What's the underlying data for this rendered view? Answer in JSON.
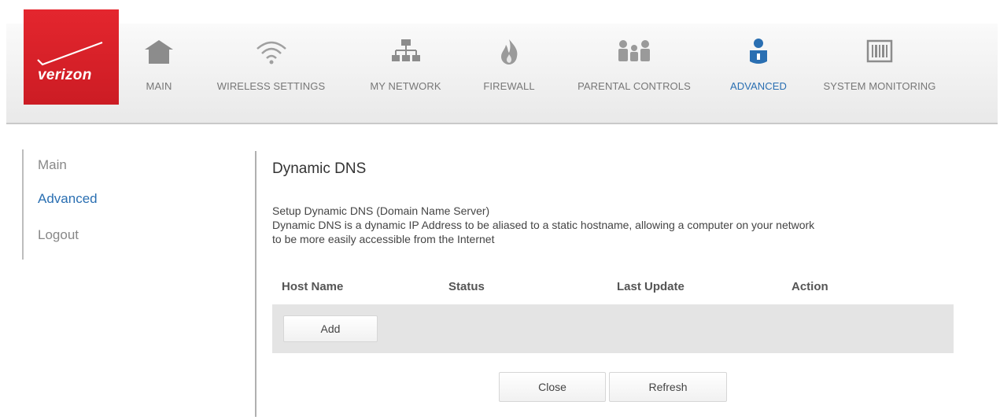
{
  "brand": {
    "logo_text": "verizon"
  },
  "nav": [
    {
      "label": "MAIN",
      "icon": "home-icon"
    },
    {
      "label": "WIRELESS SETTINGS",
      "icon": "wifi-icon"
    },
    {
      "label": "MY NETWORK",
      "icon": "network-icon"
    },
    {
      "label": "FIREWALL",
      "icon": "flame-icon"
    },
    {
      "label": "PARENTAL CONTROLS",
      "icon": "family-icon"
    },
    {
      "label": "ADVANCED",
      "icon": "user-shield-icon",
      "active": true
    },
    {
      "label": "SYSTEM MONITORING",
      "icon": "barcode-icon"
    }
  ],
  "sidebar": {
    "items": [
      {
        "label": "Main"
      },
      {
        "label": "Advanced",
        "active": true
      },
      {
        "label": "Logout"
      }
    ]
  },
  "page": {
    "title": "Dynamic DNS",
    "desc_line1": "Setup Dynamic DNS (Domain Name Server)",
    "desc_line2": "Dynamic DNS is a dynamic IP Address to be aliased to a static hostname, allowing a computer on your network",
    "desc_line3": "to be more easily accessible from the Internet"
  },
  "table": {
    "columns": [
      "Host Name",
      "Status",
      "Last Update",
      "Action"
    ],
    "add_label": "Add"
  },
  "buttons": {
    "close": "Close",
    "refresh": "Refresh"
  },
  "colors": {
    "brand_red": "#d5202a",
    "active_blue": "#2a6fb2",
    "muted_gray": "#777777"
  }
}
